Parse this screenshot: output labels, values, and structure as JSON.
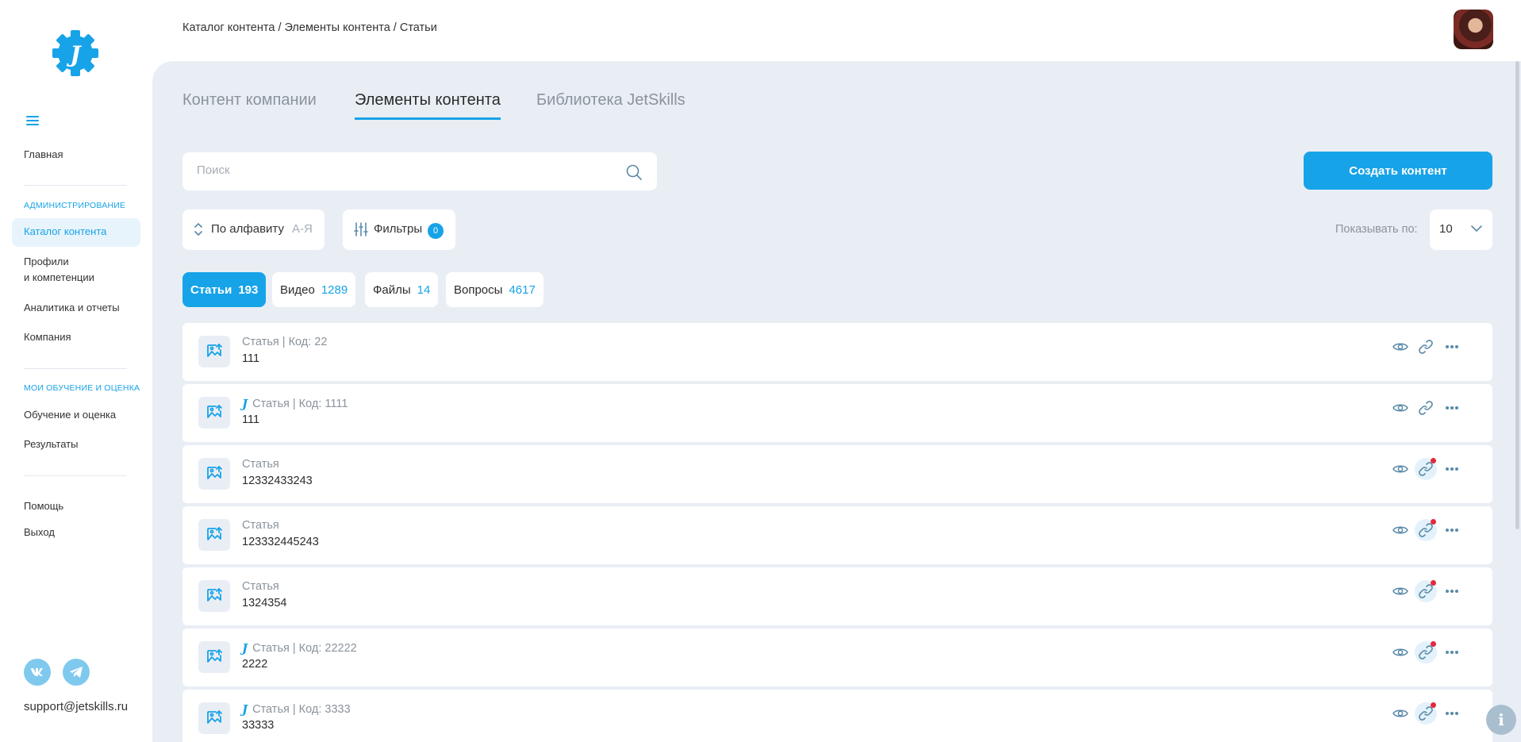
{
  "app": {
    "logo_letter": "J",
    "accent_color": "#17a3e8",
    "background_color": "#e9eef5"
  },
  "breadcrumb": "Каталог контента / Элементы контента / Статьи",
  "sidebar": {
    "home": "Главная",
    "admin_section": "АДМИНИСТРИРОВАНИЕ",
    "catalog": "Каталог контента",
    "profiles_line1": "Профили",
    "profiles_line2": "и компетенции",
    "analytics": "Аналитика и отчеты",
    "company": "Компания",
    "learning_section": "МОИ ОБУЧЕНИЕ И ОЦЕНКА",
    "learning": "Обучение и оценка",
    "results": "Результаты",
    "help": "Помощь",
    "logout": "Выход",
    "support_email": "support@jetskills.ru"
  },
  "tabs": [
    {
      "label": "Контент компании",
      "active": false
    },
    {
      "label": "Элементы контента",
      "active": true
    },
    {
      "label": "Библиотека JetSkills",
      "active": false
    }
  ],
  "search": {
    "placeholder": "Поиск",
    "value": ""
  },
  "create_button": "Создать контент",
  "sort": {
    "label": "По алфавиту",
    "order": "А-Я"
  },
  "filters": {
    "label": "Фильтры",
    "count": "0"
  },
  "page_size": {
    "label": "Показывать по:",
    "value": "10"
  },
  "content_types": [
    {
      "label": "Статьи",
      "count": "193",
      "active": true
    },
    {
      "label": "Видео",
      "count": "1289",
      "active": false
    },
    {
      "label": "Файлы",
      "count": "14",
      "active": false
    },
    {
      "label": "Вопросы",
      "count": "4617",
      "active": false
    }
  ],
  "rows": [
    {
      "meta": "Статья | Код: 22",
      "title": "111",
      "jetskills": false,
      "link_highlight": false
    },
    {
      "meta": "Статья | Код: 1111",
      "title": "111",
      "jetskills": true,
      "link_highlight": false
    },
    {
      "meta": "Статья",
      "title": "12332433243",
      "jetskills": false,
      "link_highlight": true
    },
    {
      "meta": "Статья",
      "title": "123332445243",
      "jetskills": false,
      "link_highlight": true
    },
    {
      "meta": "Статья",
      "title": "1324354",
      "jetskills": false,
      "link_highlight": true
    },
    {
      "meta": "Статья | Код: 22222",
      "title": "2222",
      "jetskills": true,
      "link_highlight": true
    },
    {
      "meta": "Статья | Код: 3333",
      "title": "33333",
      "jetskills": true,
      "link_highlight": true
    }
  ],
  "icons": {
    "row_thumb": "image-upload-icon",
    "view": "eye-icon",
    "link": "link-icon",
    "more": "more-dots-icon",
    "search": "search-icon",
    "sort": "sort-arrows-icon",
    "filter": "sliders-icon",
    "chevron": "chevron-down-icon",
    "info": "info-icon"
  }
}
